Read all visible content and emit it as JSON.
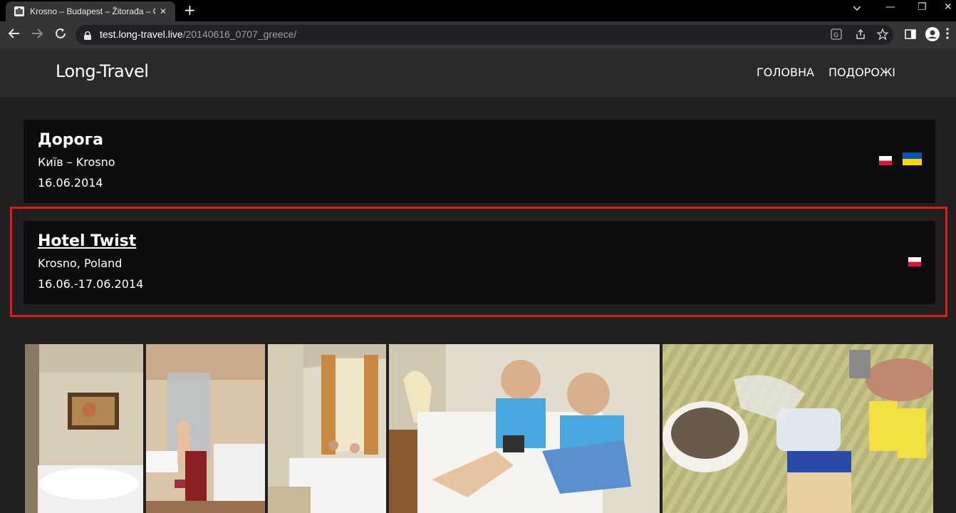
{
  "browser": {
    "tab_title": "Krosno – Budapest – Žitorađa – C",
    "tab_close": "✕",
    "new_tab": "+",
    "url_host": "test.long-travel.live",
    "url_path": "/20140616_0707_greece/",
    "controls": {
      "minimize": "—",
      "restore": "❐",
      "close": "✕"
    }
  },
  "site": {
    "logo": "Long-Travel",
    "menu": [
      "ГОЛОВНА",
      "ПОДОРОЖІ"
    ]
  },
  "cards": [
    {
      "title": "Дорога",
      "subtitle": "Київ – Krosno",
      "date": "16.06.2014",
      "flags": [
        "Poland",
        "Ukraine"
      ],
      "highlighted": false
    },
    {
      "title": "Hotel Twist",
      "subtitle": "Krosno, Poland",
      "date": "16.06.-17.06.2014",
      "flags": [
        "Poland"
      ],
      "highlighted": true
    }
  ],
  "photos": [
    {
      "subject": "hotel room bed with painting"
    },
    {
      "subject": "child in bathroom with shower"
    },
    {
      "subject": "hotel room with window and bed"
    },
    {
      "subject": "two boys on bed with tablet"
    },
    {
      "subject": "food on table"
    }
  ],
  "colors": {
    "page_bg": "#202020",
    "card_bg": "#0d0d0d",
    "header_bg": "#2a2a2a",
    "highlight_border": "#e01919"
  }
}
